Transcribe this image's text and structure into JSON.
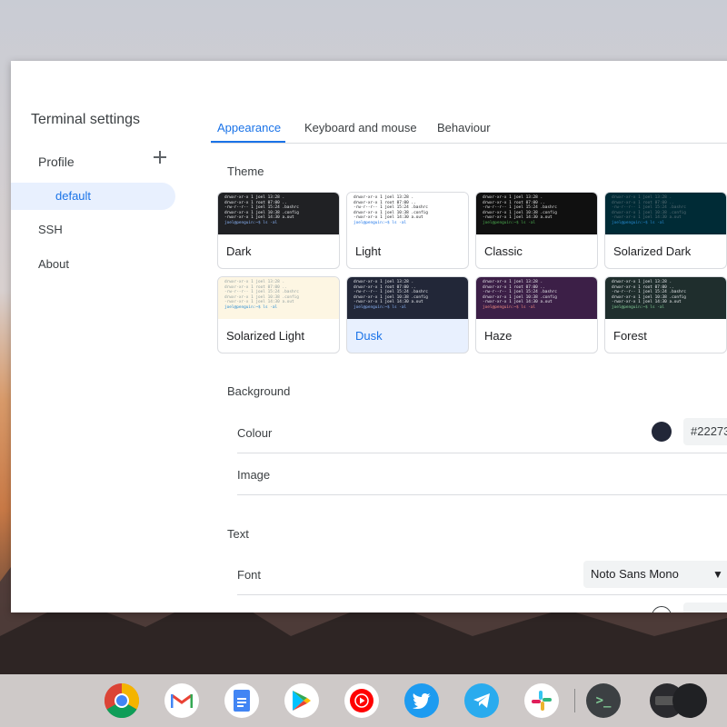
{
  "app": {
    "title": "Terminal settings"
  },
  "sidebar": {
    "profile_label": "Profile",
    "profiles": [
      {
        "label": "default"
      }
    ],
    "items": [
      {
        "label": "SSH"
      },
      {
        "label": "About"
      }
    ]
  },
  "tabs": [
    {
      "label": "Appearance",
      "active": true
    },
    {
      "label": "Keyboard and mouse",
      "active": false
    },
    {
      "label": "Behaviour",
      "active": false
    }
  ],
  "theme": {
    "section_label": "Theme",
    "preview_lines": [
      "drwxr-xr-x 1 joel 13:28 .",
      "drwxr-xr-x 1 root 07:00 ..",
      "-rw-r--r-- 1 joel 15:24 .bashrc",
      "drwxr-xr-x 1 joel 10:38 .config",
      "-rwxr-xr-x 1 joel 14:30 a.out",
      "joel@penguin:~$ ls -al"
    ],
    "cards": [
      {
        "name": "Dark",
        "bg": "#202124",
        "fg": "#e8eaed",
        "accent": "#8ab4f8",
        "selected": false
      },
      {
        "name": "Light",
        "bg": "#ffffff",
        "fg": "#202124",
        "accent": "#1a73e8",
        "selected": false
      },
      {
        "name": "Classic",
        "bg": "#101010",
        "fg": "#e0e0e0",
        "accent": "#4caf50",
        "selected": false
      },
      {
        "name": "Solarized Dark",
        "bg": "#002b36",
        "fg": "#586e75",
        "accent": "#268bd2",
        "selected": false
      },
      {
        "name": "Solarized Light",
        "bg": "#fdf6e3",
        "fg": "#93a1a1",
        "accent": "#268bd2",
        "selected": false
      },
      {
        "name": "Dusk",
        "bg": "#222738",
        "fg": "#e8eaed",
        "accent": "#8ab4f8",
        "selected": true
      },
      {
        "name": "Haze",
        "bg": "#3c1f47",
        "fg": "#e8eaed",
        "accent": "#f28b82",
        "selected": false
      },
      {
        "name": "Forest",
        "bg": "#1f2e2d",
        "fg": "#e8eaed",
        "accent": "#81c995",
        "selected": false
      }
    ]
  },
  "background": {
    "section_label": "Background",
    "colour_label": "Colour",
    "colour_value": "#22273",
    "colour_swatch": "#222738",
    "image_label": "Image"
  },
  "text": {
    "section_label": "Text",
    "font_label": "Font",
    "font_value": "Noto Sans Mono",
    "dropdown_glyph": "▼"
  },
  "shelf": {
    "apps": [
      {
        "name": "chrome"
      },
      {
        "name": "gmail"
      },
      {
        "name": "docs"
      },
      {
        "name": "play-store"
      },
      {
        "name": "youtube-music"
      },
      {
        "name": "twitter"
      },
      {
        "name": "telegram"
      },
      {
        "name": "slack"
      },
      {
        "name": "terminal"
      }
    ]
  }
}
